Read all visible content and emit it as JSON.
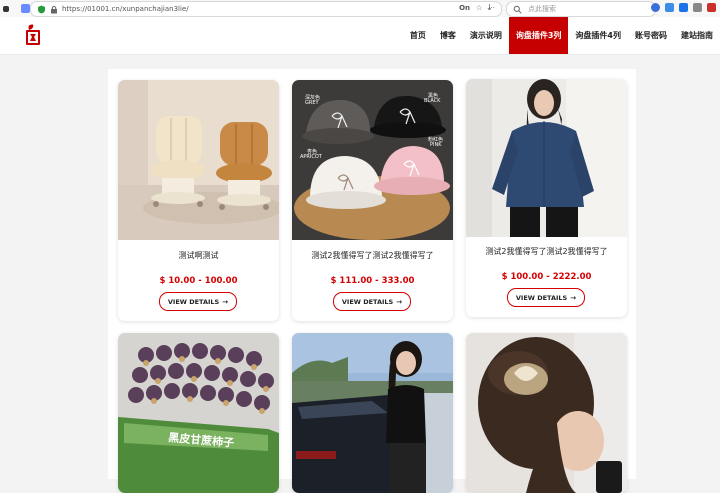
{
  "browser": {
    "url": "https://01001.cn/xunpanchajian3lie/",
    "reader_badge": "On",
    "more_label": "···",
    "search_placeholder": "点此搜索"
  },
  "nav": {
    "items": [
      {
        "label": "首页"
      },
      {
        "label": "博客"
      },
      {
        "label": "演示说明"
      },
      {
        "label": "询盘插件3列",
        "active": true
      },
      {
        "label": "询盘插件4列"
      },
      {
        "label": "账号密码"
      },
      {
        "label": "建站指南"
      }
    ]
  },
  "products": [
    {
      "title": "测试啊测试",
      "price": "$ 10.00 - 100.00",
      "button": "VIEW DETAILS",
      "image": "cushion-chairs"
    },
    {
      "title": "测试2我懂得写了测试2我懂得写了",
      "price": "$ 111.00 - 333.00",
      "button": "VIEW DETAILS",
      "image": "baseball-caps",
      "image_labels": [
        "黑色",
        "BLACK",
        "深灰色",
        "GREY",
        "杏色",
        "APRICOT",
        "粉红色",
        "PINK"
      ]
    },
    {
      "title": "测试2我懂得写了测试2我懂得写了",
      "price": "$ 100.00 - 2222.00",
      "button": "VIEW DETAILS",
      "image": "denim-shirt"
    },
    {
      "title": "",
      "price": "",
      "button": "",
      "image": "sugarcane-box",
      "image_text": "黑皮甘蔗柿子"
    },
    {
      "title": "",
      "price": "",
      "button": "",
      "image": "woman-car"
    },
    {
      "title": "",
      "price": "",
      "button": "",
      "image": "hair-claw"
    }
  ],
  "colors": {
    "accent": "#c60000",
    "price": "#d40000"
  }
}
